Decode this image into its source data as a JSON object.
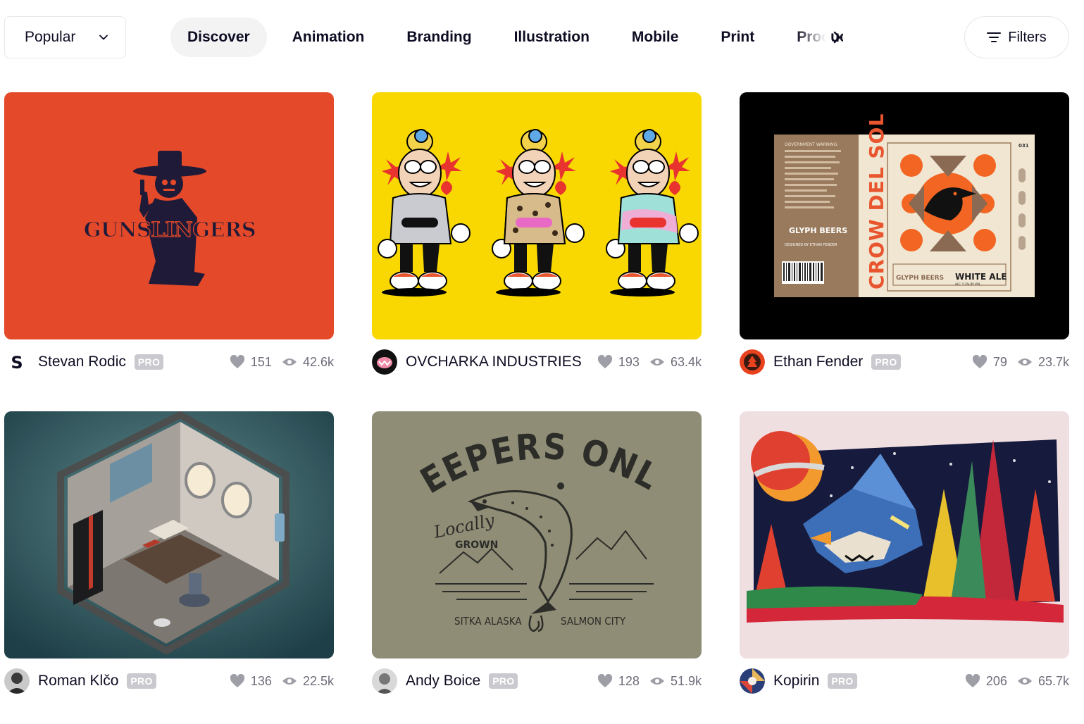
{
  "toolbar": {
    "sort_value": "Popular",
    "filters_label": "Filters"
  },
  "categories": [
    {
      "label": "Discover",
      "active": true
    },
    {
      "label": "Animation"
    },
    {
      "label": "Branding"
    },
    {
      "label": "Illustration"
    },
    {
      "label": "Mobile"
    },
    {
      "label": "Print"
    },
    {
      "label": "Product"
    }
  ],
  "shots": [
    {
      "author": "Stevan Rodic",
      "pro": "PRO",
      "likes": "151",
      "views": "42.6k",
      "artwork_text": "GUNSLINGERS",
      "bg": "#e4492a"
    },
    {
      "author": "OVCHARKA INDUSTRIES",
      "pro": "",
      "likes": "193",
      "views": "63.4k",
      "bg": "#f8d800"
    },
    {
      "author": "Ethan Fender",
      "pro": "PRO",
      "likes": "79",
      "views": "23.7k",
      "bg": "#000000",
      "artwork": {
        "vertical": "CROW DEL SOL",
        "brand": "GLYPH BEERS",
        "designer": "DESIGNED BY ETHAN FENDER",
        "ale": "WHITE ALE",
        "abv": "ALC. 5.2% BY VOL.",
        "num": "031",
        "warning": "GOVERNMENT WARNING:"
      }
    },
    {
      "author": "Roman Klčo",
      "pro": "PRO",
      "likes": "136",
      "views": "22.5k",
      "bg": "#2f5a60"
    },
    {
      "author": "Andy Boice",
      "pro": "PRO",
      "likes": "128",
      "views": "51.9k",
      "bg": "#8f8d76",
      "artwork": {
        "title": "KEEPERS ONLY",
        "sub1": "Locally",
        "sub2": "GROWN",
        "left": "SITKA ALASKA",
        "right": "SALMON CITY"
      }
    },
    {
      "author": "Kopirin",
      "pro": "PRO",
      "likes": "206",
      "views": "65.7k",
      "bg": "#efdfe1"
    }
  ]
}
